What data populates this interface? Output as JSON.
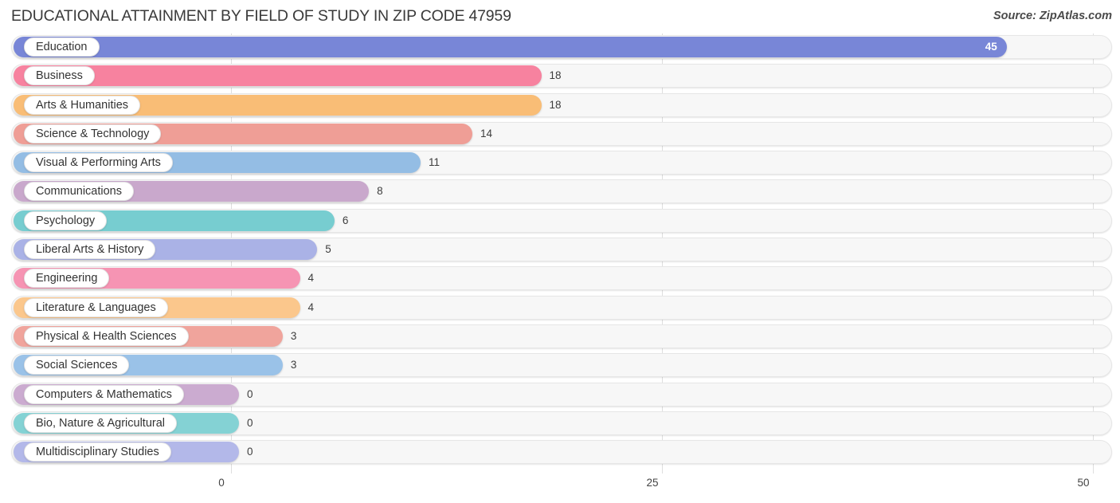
{
  "header": {
    "title": "EDUCATIONAL ATTAINMENT BY FIELD OF STUDY IN ZIP CODE 47959",
    "source": "Source: ZipAtlas.com"
  },
  "chart_data": {
    "type": "bar",
    "orientation": "horizontal",
    "title": "EDUCATIONAL ATTAINMENT BY FIELD OF STUDY IN ZIP CODE 47959",
    "xlabel": "",
    "ylabel": "",
    "xlim": [
      0,
      50
    ],
    "xticks": [
      0,
      25,
      50
    ],
    "xtick_labels": [
      "0",
      "25",
      "50"
    ],
    "grid": true,
    "legend": false,
    "categories": [
      "Education",
      "Business",
      "Arts & Humanities",
      "Science & Technology",
      "Visual & Performing Arts",
      "Communications",
      "Psychology",
      "Liberal Arts & History",
      "Engineering",
      "Literature & Languages",
      "Physical & Health Sciences",
      "Social Sciences",
      "Computers & Mathematics",
      "Bio, Nature & Agricultural",
      "Multidisciplinary Studies"
    ],
    "values": [
      45,
      18,
      18,
      14,
      11,
      8,
      6,
      5,
      4,
      4,
      3,
      3,
      0,
      0,
      0
    ],
    "value_labels": [
      "45",
      "18",
      "18",
      "14",
      "11",
      "8",
      "6",
      "5",
      "4",
      "4",
      "3",
      "3",
      "0",
      "0",
      "0"
    ],
    "colors": [
      "#7886d7",
      "#f7829f",
      "#f9bd76",
      "#ef9e96",
      "#94bde4",
      "#c9a8cc",
      "#77cdd0",
      "#aab2e6",
      "#f694b3",
      "#fbc78c",
      "#f0a49c",
      "#9ac2e8",
      "#cbabd0",
      "#84d2d4",
      "#b3b8e9"
    ]
  }
}
